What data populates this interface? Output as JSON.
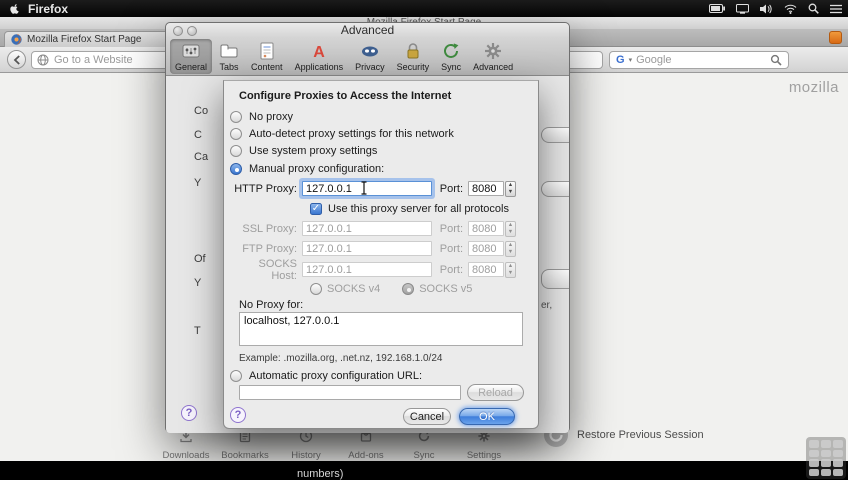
{
  "menubar": {
    "app_name": "Firefox"
  },
  "browser": {
    "window_title": "Mozilla Firefox Start Page",
    "tab_title": "Mozilla Firefox Start Page",
    "url_placeholder": "Go to a Website",
    "search_engine": "Google"
  },
  "start_page": {
    "brand": "mozilla",
    "toolbar": [
      "Downloads",
      "Bookmarks",
      "History",
      "Add-ons",
      "Sync",
      "Settings"
    ],
    "restore_label": "Restore Previous Session"
  },
  "preferences": {
    "window_title": "Advanced",
    "toolbar_tabs": [
      "General",
      "Tabs",
      "Content",
      "Applications",
      "Privacy",
      "Security",
      "Sync",
      "Advanced"
    ],
    "selected_tab": "General",
    "help_label": "?",
    "left_fragments": [
      "Co",
      "C",
      "Ca",
      "Y",
      "Of",
      "Y",
      "T"
    ],
    "right_fragment": "er,"
  },
  "connection_dialog": {
    "heading": "Configure Proxies to Access the Internet",
    "options": [
      "No proxy",
      "Auto-detect proxy settings for this network",
      "Use system proxy settings",
      "Manual proxy configuration:"
    ],
    "selected_option": "Manual proxy configuration:",
    "proxy_rows": [
      {
        "label": "HTTP Proxy:",
        "value": "127.0.0.1",
        "port_label": "Port:",
        "port": "8080",
        "enabled": true,
        "focused": true
      },
      {
        "label": "SSL Proxy:",
        "value": "127.0.0.1",
        "port_label": "Port:",
        "port": "8080",
        "enabled": false
      },
      {
        "label": "FTP Proxy:",
        "value": "127.0.0.1",
        "port_label": "Port:",
        "port": "8080",
        "enabled": false
      },
      {
        "label": "SOCKS Host:",
        "value": "127.0.0.1",
        "port_label": "Port:",
        "port": "8080",
        "enabled": false
      }
    ],
    "share_checkbox_label": "Use this proxy server for all protocols",
    "share_checkbox_checked": true,
    "socks_v4_label": "SOCKS v4",
    "socks_v5_label": "SOCKS v5",
    "socks_selected": "SOCKS v5",
    "no_proxy_label": "No Proxy for:",
    "no_proxy_value": "localhost, 127.0.0.1",
    "example_text": "Example: .mozilla.org, .net.nz, 192.168.1.0/24",
    "auto_config_label": "Automatic proxy configuration URL:",
    "auto_config_value": "",
    "reload_label": "Reload",
    "help_label": "?",
    "cancel_label": "Cancel",
    "ok_label": "OK"
  },
  "icons": {
    "stepper-up-icon": "▲",
    "stepper-down-icon": "▼",
    "checkmark-icon": "✓",
    "caret-down-icon": "▾",
    "google-g-icon": "G",
    "back-icon": "‹"
  },
  "colors": {
    "accent_blue": "#3f7edb",
    "focus_ring": "#6fa3e8"
  },
  "caption_fragment": "numbers)"
}
